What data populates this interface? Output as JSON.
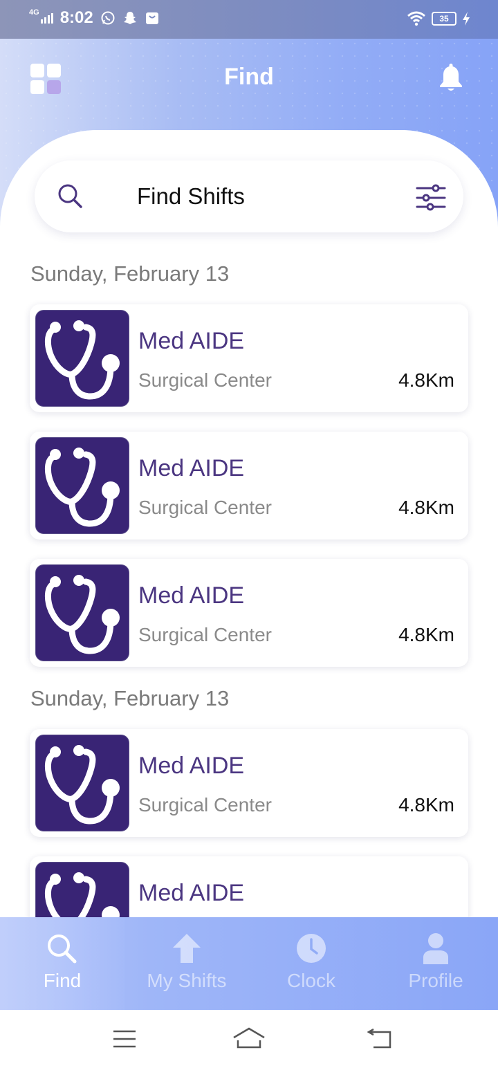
{
  "status_bar": {
    "network": "4G",
    "time": "8:02",
    "battery": "35"
  },
  "header": {
    "title": "Find"
  },
  "search": {
    "placeholder": "Find Shifts"
  },
  "sections": [
    {
      "date": "Sunday, February 13",
      "shifts": [
        {
          "title": "Med AIDE",
          "location": "Surgical Center",
          "distance": "4.8Km"
        },
        {
          "title": "Med AIDE",
          "location": "Surgical Center",
          "distance": "4.8Km"
        },
        {
          "title": "Med AIDE",
          "location": "Surgical Center",
          "distance": "4.8Km"
        }
      ]
    },
    {
      "date": "Sunday, February 13",
      "shifts": [
        {
          "title": "Med AIDE",
          "location": "Surgical Center",
          "distance": "4.8Km"
        },
        {
          "title": "Med AIDE",
          "location": "",
          "distance": ""
        }
      ]
    }
  ],
  "bottom_nav": [
    {
      "label": "Find",
      "icon": "search-icon",
      "active": true
    },
    {
      "label": "My Shifts",
      "icon": "upload-arrow-icon",
      "active": false
    },
    {
      "label": "Clock",
      "icon": "clock-icon",
      "active": false
    },
    {
      "label": "Profile",
      "icon": "person-icon",
      "active": false
    }
  ],
  "colors": {
    "accent": "#392475",
    "title_text": "#4b3681",
    "header_gradient_start": "#d4ddf8",
    "header_gradient_end": "#86a3f7"
  }
}
